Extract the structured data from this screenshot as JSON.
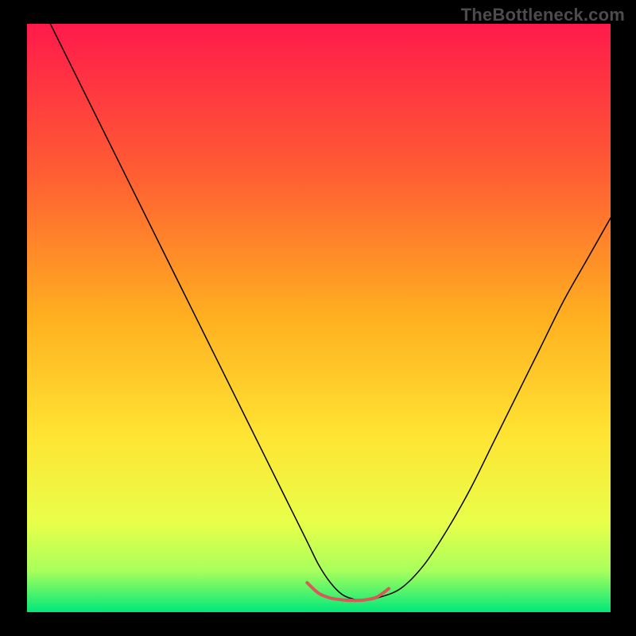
{
  "watermark": "TheBottleneck.com",
  "chart_data": {
    "type": "line",
    "title": "",
    "xlabel": "",
    "ylabel": "",
    "xlim": [
      0,
      100
    ],
    "ylim": [
      0,
      100
    ],
    "background": {
      "type": "vertical-gradient",
      "stops": [
        {
          "offset": 0.0,
          "color": "#ff1a4b"
        },
        {
          "offset": 0.25,
          "color": "#ff5c33"
        },
        {
          "offset": 0.5,
          "color": "#ffb020"
        },
        {
          "offset": 0.7,
          "color": "#ffe433"
        },
        {
          "offset": 0.85,
          "color": "#e8ff4a"
        },
        {
          "offset": 0.93,
          "color": "#a8ff5c"
        },
        {
          "offset": 1.0,
          "color": "#00e87a"
        }
      ]
    },
    "series": [
      {
        "name": "bottleneck-curve",
        "color": "#000000",
        "width": 1.5,
        "x": [
          4,
          8,
          12,
          16,
          20,
          24,
          28,
          32,
          36,
          40,
          44,
          48,
          50,
          52,
          54,
          56,
          58,
          60,
          64,
          68,
          72,
          76,
          80,
          84,
          88,
          92,
          96,
          100
        ],
        "y": [
          100,
          92,
          84,
          76,
          68,
          60,
          52,
          44,
          36,
          28,
          20,
          12,
          8,
          5,
          3,
          2.2,
          2,
          2.4,
          4,
          8,
          14,
          21,
          29,
          37,
          45,
          53,
          60,
          67
        ]
      },
      {
        "name": "optimal-band",
        "color": "#d75a5a",
        "width": 4,
        "x": [
          48,
          50,
          52,
          54,
          56,
          58,
          60,
          62
        ],
        "y": [
          5,
          3.2,
          2.4,
          2.1,
          2.0,
          2.1,
          2.6,
          4
        ]
      }
    ]
  }
}
